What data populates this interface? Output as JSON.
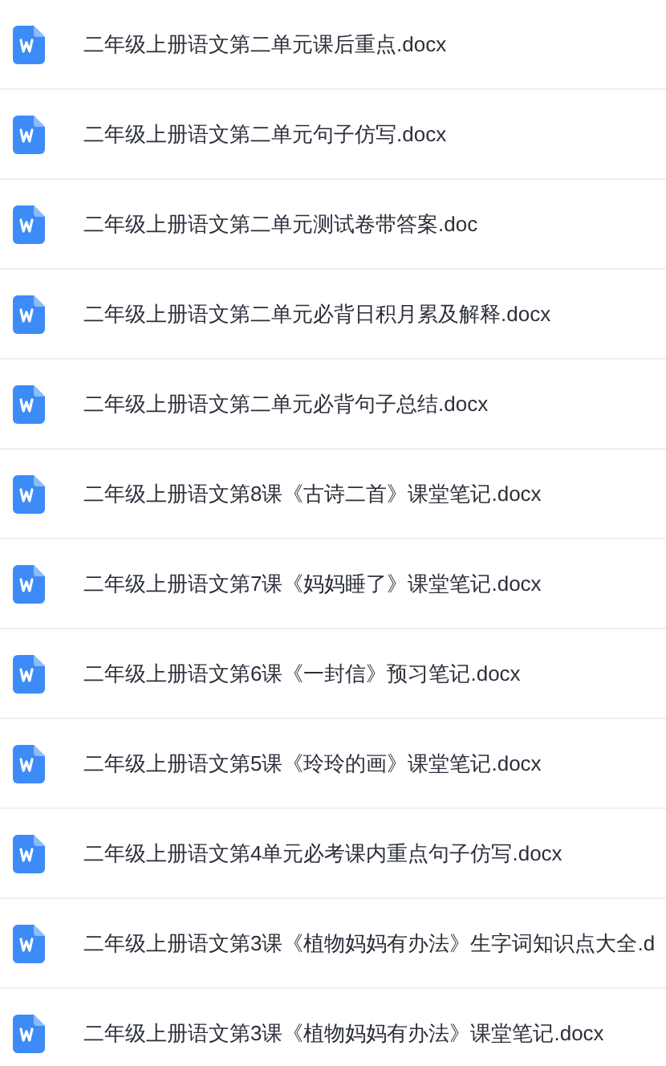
{
  "files": [
    {
      "name": "二年级上册语文第二单元课后重点.docx"
    },
    {
      "name": "二年级上册语文第二单元句子仿写.docx"
    },
    {
      "name": "二年级上册语文第二单元测试卷带答案.doc"
    },
    {
      "name": "二年级上册语文第二单元必背日积月累及解释.docx"
    },
    {
      "name": "二年级上册语文第二单元必背句子总结.docx"
    },
    {
      "name": "二年级上册语文第8课《古诗二首》课堂笔记.docx"
    },
    {
      "name": "二年级上册语文第7课《妈妈睡了》课堂笔记.docx"
    },
    {
      "name": "二年级上册语文第6课《一封信》预习笔记.docx"
    },
    {
      "name": "二年级上册语文第5课《玲玲的画》课堂笔记.docx"
    },
    {
      "name": "二年级上册语文第4单元必考课内重点句子仿写.docx"
    },
    {
      "name": "二年级上册语文第3课《植物妈妈有办法》生字词知识点大全.d"
    },
    {
      "name": "二年级上册语文第3课《植物妈妈有办法》课堂笔记.docx"
    }
  ]
}
